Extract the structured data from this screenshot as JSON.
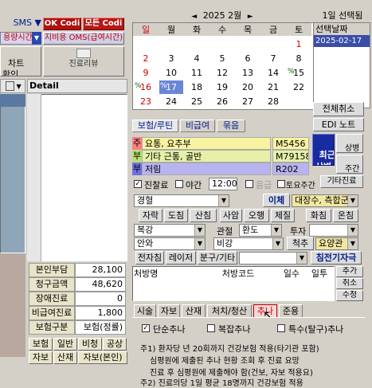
{
  "top_left": {
    "sms_label": "SMS",
    "ok_codi": "OK Codi",
    "codi2": "모든 Codi",
    "usage_combo": "용량시간",
    "oms_label": "지비용 OMS(급여시간)",
    "chart_confirm": "차트\n확인",
    "treatment_review": "진료리뷰"
  },
  "calendar": {
    "year_month": "2025 2월",
    "prev_arrow": "◄",
    "next_arrow": "►",
    "weekdays": [
      "일",
      "월",
      "화",
      "수",
      "목",
      "금",
      "토"
    ],
    "weeks": [
      [
        "",
        "",
        "",
        "",
        "",
        "",
        "1"
      ],
      [
        "2",
        "3",
        "4",
        "5",
        "6",
        "7",
        "8"
      ],
      [
        "9",
        "10",
        "11",
        "12",
        "13",
        "14",
        "15"
      ],
      [
        "16",
        "17",
        "18",
        "19",
        "20",
        "21",
        "22"
      ],
      [
        "23",
        "24",
        "25",
        "26",
        "27",
        "28",
        ""
      ]
    ],
    "markers": {
      "16": "%",
      "17": "%",
      "15": "%"
    },
    "selected_day": "17"
  },
  "date_panel": {
    "select_label": "1일 선택됨",
    "header": "선택날짜",
    "selected_date": "2025-02-17"
  },
  "buttons": {
    "cancel_all": "전체취소",
    "edi_note": "EDI 노트",
    "reset": "취소",
    "modify": "수정",
    "add": "추가"
  },
  "tabs_top": [
    "보험/루틴",
    "비급여",
    "묶음"
  ],
  "diagnoses": [
    {
      "prefix": "주",
      "name": "요통, 요추부",
      "code": "M5456"
    },
    {
      "prefix": "부",
      "name": "기타 근통, 골반",
      "code": "M79158"
    },
    {
      "prefix": "부",
      "name": "저림",
      "code": "R202"
    }
  ],
  "side_buttons": {
    "recent_disease": "최근\n상병",
    "disease_mgmt": "상병\n관리",
    "main_symptom": "주간\n요약",
    "other_treatment": "기타진료"
  },
  "options_row": {
    "treatment_effect": "진찰료",
    "night": "야간",
    "time": "12:00",
    "saturday": "토요주간",
    "pause": "음급"
  },
  "row_combos": {
    "r1_left": "경혈",
    "r1_btn": "이체",
    "r1_right": "대장수, 측합군",
    "r2": [
      "자락",
      "도침",
      "산침",
      "사암",
      "오행",
      "체질",
      "화침",
      "온침"
    ],
    "r3_left": "복강",
    "r3_mid_label": "관절",
    "r3_mid_val": "환도",
    "r3_right": "투자",
    "r4_left": "안와",
    "r4_mid": "비강",
    "r4_right_label": "척추",
    "r4_right_val": "요양관",
    "r5": [
      "전자침",
      "레이저",
      "분구/기타"
    ],
    "r5_btn": "침전기자극"
  },
  "prescription_table": {
    "columns": [
      "처방명",
      "처방코드",
      "일수",
      "일투",
      "추가"
    ]
  },
  "tabs_bottom": [
    "시술",
    "자보",
    "산재",
    "처치/청산",
    "추나",
    "준용"
  ],
  "chuna": {
    "simple": "단순추나",
    "complex": "복잡추나",
    "special": "특수(탈구)추나"
  },
  "notes": [
    "주1) 환자당 년 20회까지 건강보험 적용(타기관 포함)",
    "심평원에 제출된 추나 현황 조회 후 진료 요망",
    "진료 후 심평원에 제출해야 함(건보, 자보 적용요)",
    "주2) 진료의당 1일 평균 18명까지 건강보험 적용"
  ],
  "left_panel": {
    "detail_label": "Detail",
    "fees": [
      {
        "label": "본인부담",
        "value": "28,100"
      },
      {
        "label": "청구금액",
        "value": "48,620"
      },
      {
        "label": "장애진료",
        "value": "0"
      },
      {
        "label": "비급여진료",
        "value": "1,800"
      },
      {
        "label": "보험구분",
        "value": "보험(정률)"
      }
    ],
    "type_buttons_row1": [
      "보험",
      "일반",
      "비청",
      "공상"
    ],
    "type_buttons_row2": [
      "자보",
      "산재",
      "자보(본인)"
    ]
  },
  "colors": {
    "diag_main": "#f7f3a0",
    "diag_sub1": "#e6f0a8",
    "diag_sub2": "#b8b4f0",
    "selected_date_bg": "#3a4ea8",
    "cal_selected": "#6a86d8"
  }
}
